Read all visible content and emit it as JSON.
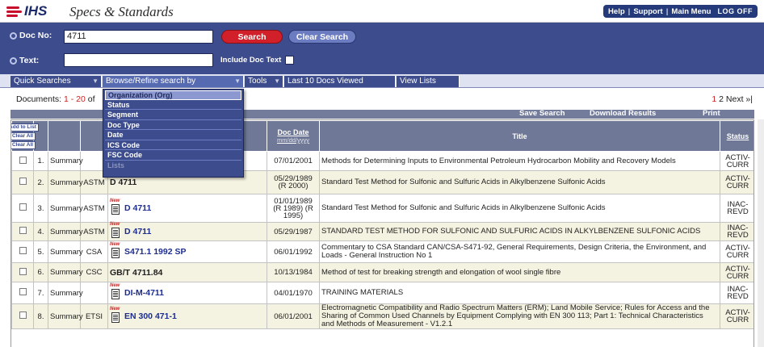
{
  "header": {
    "logo_text": "IHS",
    "app_title": "Specs & Standards",
    "nav": [
      "Help",
      "Support",
      "Main Menu",
      "LOG OFF"
    ]
  },
  "search": {
    "doc_no_label": "Doc No:",
    "doc_no_value": "4711",
    "text_label": "Text:",
    "text_value": "",
    "search_button": "Search",
    "clear_button": "Clear Search",
    "include_doc_text_label": "Include Doc Text"
  },
  "menubar": {
    "items": [
      "Quick Searches",
      "Browse/Refine search by",
      "Tools",
      "Last 10 Docs Viewed",
      "View Lists"
    ]
  },
  "dropdown": {
    "items": [
      "Organization (Org)",
      "Status",
      "Segment",
      "Doc Type",
      "Date",
      "ICS Code",
      "FSC Code",
      "Lists"
    ],
    "selected_index": 0,
    "disabled_index": 7
  },
  "results_info": {
    "prefix": "Documents: ",
    "range": "1 - 20",
    "suffix": " of",
    "pager_current": "1",
    "pager_rest": " 2  Next »|"
  },
  "actions": {
    "save_search": "Save Search",
    "download_results": "Download Results",
    "print": "Print"
  },
  "table": {
    "header_buttons": [
      "Add to List",
      "Clear All",
      "Clear All"
    ],
    "headers": {
      "date": "Doc Date",
      "date_format": "mm/dd/yyyy",
      "title": "Title",
      "status": "Status"
    },
    "rows": [
      {
        "num": "1.",
        "summary": "Summary",
        "pub": "",
        "doc": "",
        "new": false,
        "date": "07/01/2001",
        "title": "Methods for Determining Inputs to Environmental Petroleum Hydrocarbon Mobility and Recovery Models",
        "status": "ACTIV-CURR"
      },
      {
        "num": "2.",
        "summary": "Summary",
        "pub": "ASTM",
        "doc": "D 4711",
        "new": false,
        "date": "05/29/1989 (R 2000)",
        "title": "Standard Test Method for Sulfonic and Sulfuric Acids in Alkylbenzene Sulfonic Acids",
        "status": "ACTIV-CURR"
      },
      {
        "num": "3.",
        "summary": "Summary",
        "pub": "ASTM",
        "doc": "D 4711",
        "new": true,
        "date": "01/01/1989 (R 1989) (R 1995)",
        "title": "Standard Test Method for Sulfonic and Sulfuric Acids in Alkylbenzene Sulfonic Acids",
        "status": "INAC-REVD"
      },
      {
        "num": "4.",
        "summary": "Summary",
        "pub": "ASTM",
        "doc": "D 4711",
        "new": true,
        "date": "05/29/1987",
        "title": "STANDARD TEST METHOD FOR SULFONIC AND SULFURIC ACIDS IN ALKYLBENZENE SULFONIC ACIDS",
        "status": "INAC-REVD"
      },
      {
        "num": "5.",
        "summary": "Summary",
        "pub": "CSA",
        "doc": "S471.1 1992 SP",
        "new": true,
        "date": "06/01/1992",
        "title": "Commentary to CSA Standard CAN/CSA-S471-92, General Requirements, Design Criteria, the Environment, and Loads - General Instruction No 1",
        "status": "ACTIV-CURR"
      },
      {
        "num": "6.",
        "summary": "Summary",
        "pub": "CSC",
        "doc": "GB/T 4711.84",
        "new": false,
        "date": "10/13/1984",
        "title": "Method of test for breaking strength and elongation of wool single fibre",
        "status": "ACTIV-CURR"
      },
      {
        "num": "7.",
        "summary": "Summary",
        "pub": "",
        "doc": "DI-M-4711",
        "new": true,
        "date": "04/01/1970",
        "title": "TRAINING MATERIALS",
        "status": "INAC-REVD"
      },
      {
        "num": "8.",
        "summary": "Summary",
        "pub": "ETSI",
        "doc": "EN 300 471-1",
        "new": true,
        "date": "06/01/2001",
        "title": "Electromagnetic Compatibility and Radio Spectrum Matters (ERM); Land Mobile Service; Rules for Access and the Sharing of Common Used Channels by Equipment Complying with EN 300 113; Part 1: Technical Characteristics and Methods of Measurement - V1.2.1",
        "status": "ACTIV-CURR"
      }
    ]
  }
}
